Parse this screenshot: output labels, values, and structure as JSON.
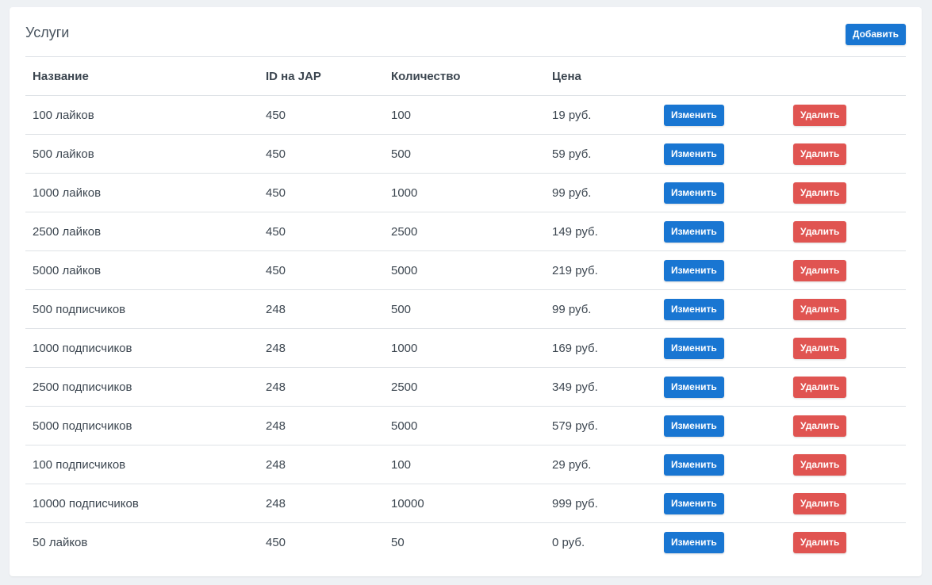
{
  "title": "Услуги",
  "add_button": "Добавить",
  "columns": {
    "name": "Название",
    "jap_id": "ID на JAP",
    "quantity": "Количество",
    "price": "Цена"
  },
  "row_actions": {
    "edit": "Изменить",
    "delete": "Удалить"
  },
  "rows": [
    {
      "name": "100 лайков",
      "jap_id": "450",
      "quantity": "100",
      "price": "19 руб."
    },
    {
      "name": "500 лайков",
      "jap_id": "450",
      "quantity": "500",
      "price": "59 руб."
    },
    {
      "name": "1000 лайков",
      "jap_id": "450",
      "quantity": "1000",
      "price": "99 руб."
    },
    {
      "name": "2500 лайков",
      "jap_id": "450",
      "quantity": "2500",
      "price": "149 руб."
    },
    {
      "name": "5000 лайков",
      "jap_id": "450",
      "quantity": "5000",
      "price": "219 руб."
    },
    {
      "name": "500 подписчиков",
      "jap_id": "248",
      "quantity": "500",
      "price": "99 руб."
    },
    {
      "name": "1000 подписчиков",
      "jap_id": "248",
      "quantity": "1000",
      "price": "169 руб."
    },
    {
      "name": "2500 подписчиков",
      "jap_id": "248",
      "quantity": "2500",
      "price": "349 руб."
    },
    {
      "name": "5000 подписчиков",
      "jap_id": "248",
      "quantity": "5000",
      "price": "579 руб."
    },
    {
      "name": "100 подписчиков",
      "jap_id": "248",
      "quantity": "100",
      "price": "29 руб."
    },
    {
      "name": "10000 подписчиков",
      "jap_id": "248",
      "quantity": "10000",
      "price": "999 руб."
    },
    {
      "name": "50 лайков",
      "jap_id": "450",
      "quantity": "50",
      "price": "0 руб."
    }
  ],
  "colors": {
    "primary": "#1976d2",
    "danger": "#e05451",
    "background": "#eef1f4"
  }
}
